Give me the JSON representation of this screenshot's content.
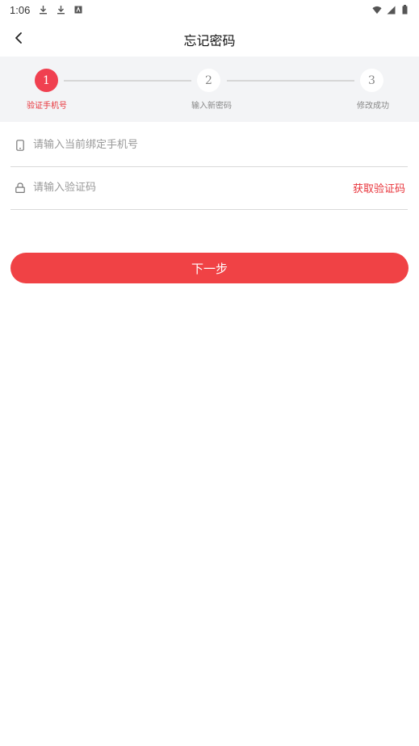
{
  "status_bar": {
    "time": "1:06",
    "icons": [
      "download-icon",
      "download-icon",
      "app-notification-icon"
    ],
    "right_icons": [
      "wifi-icon",
      "signal-icon",
      "battery-icon"
    ]
  },
  "header": {
    "title": "忘记密码",
    "back_icon": "chevron-left-icon"
  },
  "stepper": {
    "steps": [
      {
        "number": "1",
        "label": "验证手机号",
        "active": true
      },
      {
        "number": "2",
        "label": "输入新密码",
        "active": false
      },
      {
        "number": "3",
        "label": "修改成功",
        "active": false
      }
    ]
  },
  "form": {
    "phone": {
      "placeholder": "请输入当前绑定手机号",
      "value": "",
      "icon": "phone-icon"
    },
    "code": {
      "placeholder": "请输入验证码",
      "value": "",
      "icon": "lock-icon",
      "action_label": "获取验证码"
    }
  },
  "actions": {
    "next_label": "下一步"
  },
  "colors": {
    "accent": "#f04245",
    "accent_text": "#e8333a",
    "stepper_bg": "#f3f4f6"
  }
}
